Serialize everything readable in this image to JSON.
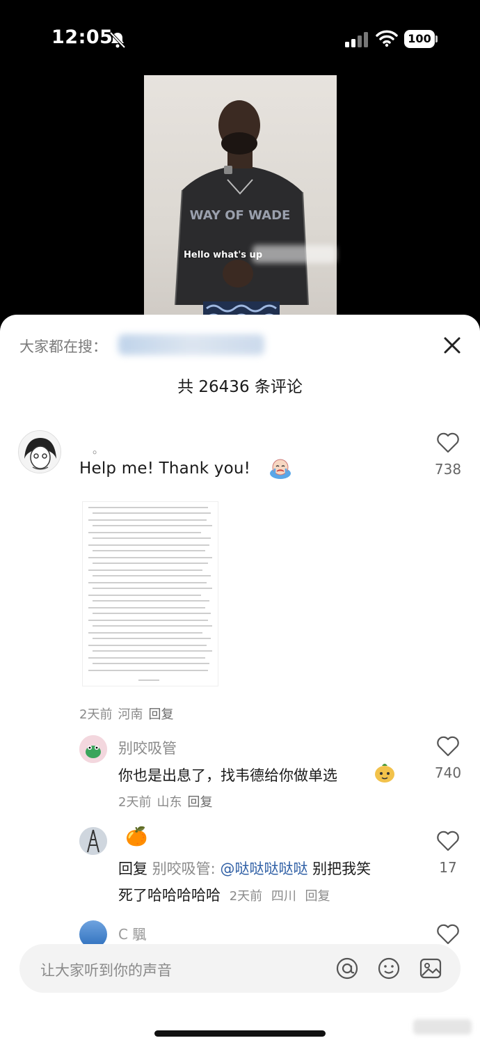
{
  "status_bar": {
    "time": "12:05",
    "battery": "100",
    "icons": [
      "bell-off-icon",
      "signal-icon",
      "wifi-icon",
      "battery-icon"
    ]
  },
  "video": {
    "caption": "Hello what's up"
  },
  "sheet": {
    "search_hint": "大家都在搜：",
    "comment_count": "共 26436 条评论",
    "close_icon": "close-icon"
  },
  "comments": [
    {
      "username": "。",
      "text": "Help  me!   Thank you!",
      "likes": "738",
      "time": "2天前",
      "location": "河南",
      "reply_label": "回复",
      "has_image": true
    },
    {
      "username": "别咬吸管",
      "text": "你也是出息了，找韦德给你做单选",
      "likes": "740",
      "time": "2天前",
      "location": "山东",
      "reply_label": "回复"
    },
    {
      "username": "🍊",
      "reply_prefix": "回复",
      "reply_to": "别咬吸管:",
      "mention": "@哒哒哒哒哒",
      "text_line1_tail": "别把我笑",
      "text_line2": "死了哈哈哈哈哈",
      "likes": "17",
      "time": "2天前",
      "location": "四川",
      "reply_label": "回复"
    },
    {
      "username": "C 颿"
    }
  ],
  "input": {
    "placeholder": "让大家听到你的声音"
  },
  "colors": {
    "sheet_bg": "#ffffff",
    "mention": "#2f5fa5",
    "meta": "#8a8a8a",
    "input_bg": "#f3f3f3"
  }
}
